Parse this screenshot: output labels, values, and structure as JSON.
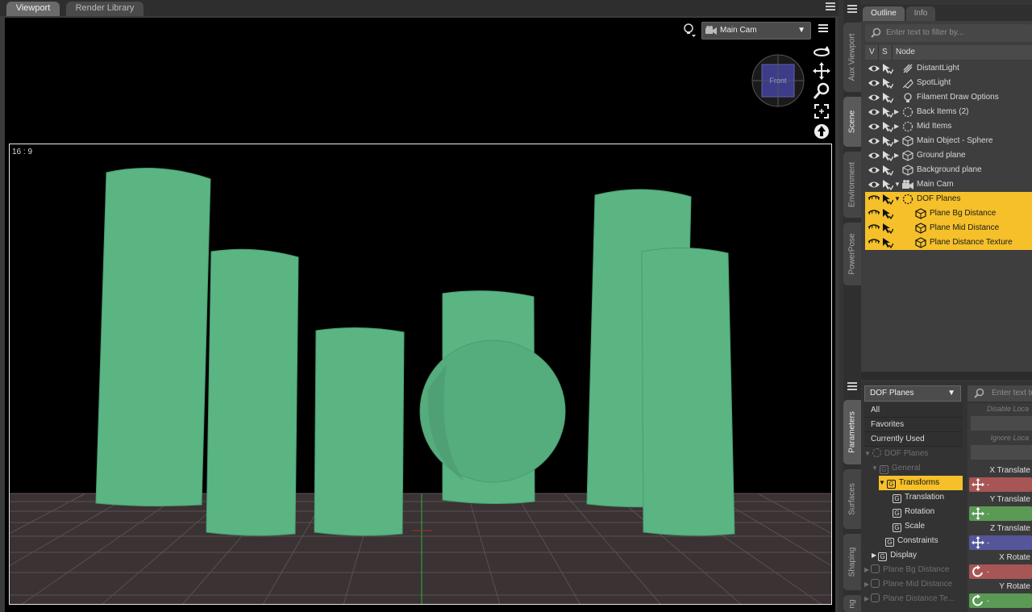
{
  "viewport_tabs": [
    "Viewport",
    "Render Library"
  ],
  "viewport": {
    "camera_select": "Main Cam",
    "aspect_ratio": "16 : 9",
    "cube_face": "Front",
    "nav_tools": [
      "orbit-icon",
      "pan-icon",
      "zoom-icon",
      "frame-icon",
      "reset-view-icon"
    ]
  },
  "side_tabs_top": [
    "Aux Viewport",
    "Scene",
    "Environment",
    "PowerPose"
  ],
  "side_tabs_bottom": [
    "Parameters",
    "Surfaces",
    "Shaping",
    "ng"
  ],
  "outline": {
    "tabs": [
      "Outline",
      "Info"
    ],
    "filter_placeholder": "Enter text to filter by...",
    "columns": [
      "V",
      "S",
      "Node"
    ],
    "rows": [
      {
        "label": "DistantLight",
        "icon": "distant-light-icon",
        "selected": false
      },
      {
        "label": "SpotLight",
        "icon": "spotlight-icon",
        "selected": false
      },
      {
        "label": "Filament Draw Options",
        "icon": "filament-icon",
        "selected": false
      },
      {
        "label": "Back Items (2)",
        "icon": "group-icon",
        "selected": false
      },
      {
        "label": "Mid Items",
        "icon": "group-icon",
        "selected": false
      },
      {
        "label": "Main Object - Sphere",
        "icon": "object-icon",
        "selected": false
      },
      {
        "label": "Ground plane",
        "icon": "object-icon",
        "selected": false
      },
      {
        "label": "Background plane",
        "icon": "object-icon",
        "selected": false
      },
      {
        "label": "Main Cam",
        "icon": "camera-icon",
        "selected": false
      },
      {
        "label": "DOF Planes",
        "icon": "group-icon",
        "selected": true
      },
      {
        "label": "Plane Bg Distance",
        "icon": "object-icon",
        "selected": true
      },
      {
        "label": "Plane Mid Distance",
        "icon": "object-icon",
        "selected": true
      },
      {
        "label": "Plane Distance Texture",
        "icon": "object-icon",
        "selected": true
      }
    ]
  },
  "parameters": {
    "node_select": "DOF Planes",
    "filters": [
      "All",
      "Favorites",
      "Currently Used"
    ],
    "tree": [
      {
        "label": "DOF Planes",
        "dim": true,
        "selected": false
      },
      {
        "label": "General",
        "dim": true,
        "selected": false
      },
      {
        "label": "Transforms",
        "dim": false,
        "selected": true
      },
      {
        "label": "Translation",
        "dim": false,
        "selected": false
      },
      {
        "label": "Rotation",
        "dim": false,
        "selected": false
      },
      {
        "label": "Scale",
        "dim": false,
        "selected": false
      },
      {
        "label": "Constraints",
        "dim": false,
        "selected": false
      },
      {
        "label": "Display",
        "dim": false,
        "selected": false
      },
      {
        "label": "Plane Bg Distance",
        "dim": true,
        "selected": false
      },
      {
        "label": "Plane Mid Distance",
        "dim": true,
        "selected": false
      },
      {
        "label": "Plane Distance Te...",
        "dim": true,
        "selected": false
      }
    ],
    "search_placeholder": "Enter text to",
    "locks": [
      "Disable Loca",
      "Ignore Loca"
    ],
    "props": [
      {
        "label": "X Translate",
        "color": "#a85555",
        "icon": "translate-icon",
        "value": "-"
      },
      {
        "label": "Y Translate",
        "color": "#5a9a55",
        "icon": "translate-icon",
        "value": "-"
      },
      {
        "label": "Z Translate",
        "color": "#55559a",
        "icon": "translate-icon",
        "value": "-"
      },
      {
        "label": "X Rotate",
        "color": "#a85555",
        "icon": "rotate-icon",
        "value": "-"
      },
      {
        "label": "Y Rotate",
        "color": "#5a9a55",
        "icon": "rotate-icon",
        "value": "-"
      }
    ]
  },
  "colors": {
    "selection": "#f5c02a",
    "object_green": "#5ab583",
    "ground": "#3a3233"
  }
}
